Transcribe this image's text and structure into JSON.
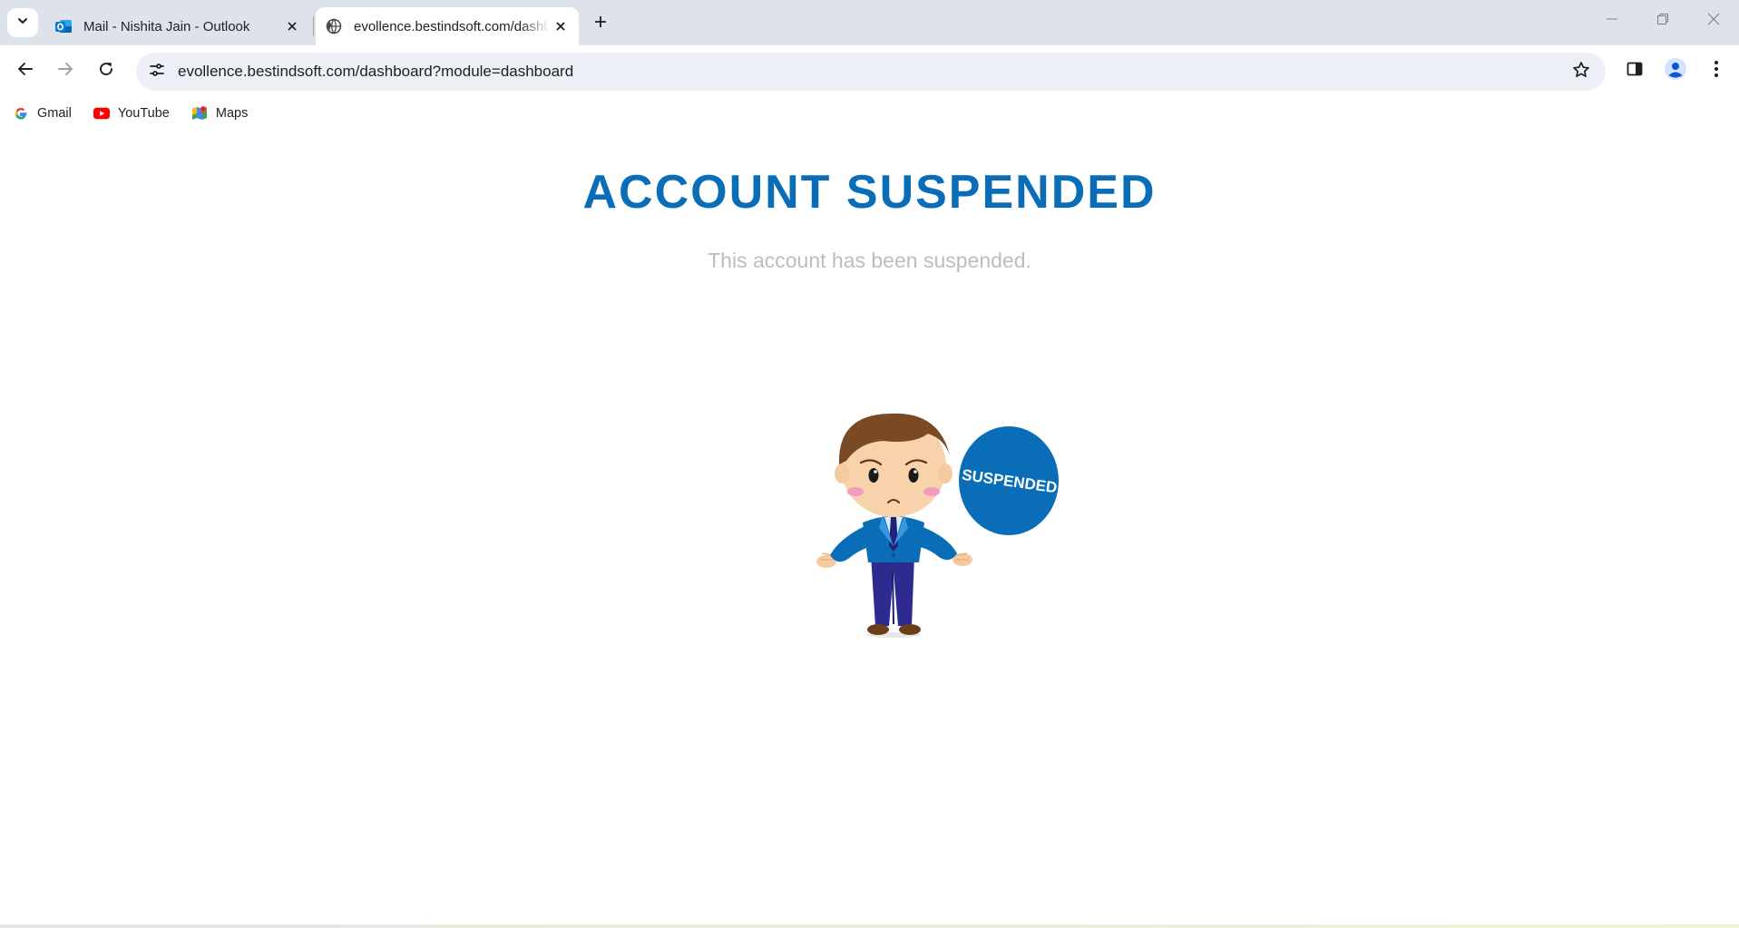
{
  "browser": {
    "tabs": [
      {
        "title": "Mail - Nishita Jain - Outlook",
        "icon": "outlook-icon",
        "active": false
      },
      {
        "title": "evollence.bestindsoft.com/dashboard?module=dashboard",
        "icon": "globe-icon",
        "active": true
      }
    ],
    "address_bar": {
      "url": "evollence.bestindsoft.com/dashboard?module=dashboard"
    },
    "bookmarks": [
      {
        "label": "Gmail",
        "icon": "google-icon"
      },
      {
        "label": "YouTube",
        "icon": "youtube-icon"
      },
      {
        "label": "Maps",
        "icon": "maps-icon"
      }
    ]
  },
  "page": {
    "headline": "ACCOUNT SUSPENDED",
    "message": "This account has been suspended.",
    "badge_text": "SUSPENDED"
  },
  "colors": {
    "accent": "#0a6db8",
    "message": "#bcbcc4",
    "tabstrip": "#dee3eb",
    "omnibox": "#edf0f6"
  }
}
